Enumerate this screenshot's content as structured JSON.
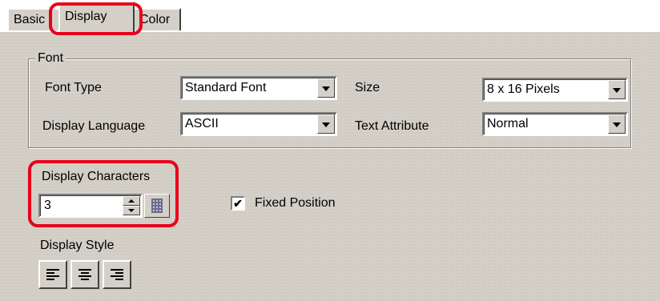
{
  "tabs": [
    {
      "label": "Basic",
      "active": false
    },
    {
      "label": "Display",
      "active": true
    },
    {
      "label": "Color",
      "active": false
    }
  ],
  "font_group": {
    "title": "Font",
    "font_type": {
      "label": "Font Type",
      "value": "Standard Font"
    },
    "size": {
      "label": "Size",
      "value": "8 x 16 Pixels"
    },
    "display_language": {
      "label": "Display Language",
      "value": "ASCII"
    },
    "text_attribute": {
      "label": "Text Attribute",
      "value": "Normal"
    }
  },
  "display_characters": {
    "label": "Display Characters",
    "value": "3"
  },
  "fixed_position": {
    "label": "Fixed Position",
    "checked": true,
    "mark": "✔"
  },
  "display_style": {
    "label": "Display Style",
    "buttons": [
      "align-left-icon",
      "align-center-icon",
      "align-right-icon"
    ]
  },
  "colors": {
    "highlight": "#e8001c",
    "panel": "#d4d0c8"
  }
}
